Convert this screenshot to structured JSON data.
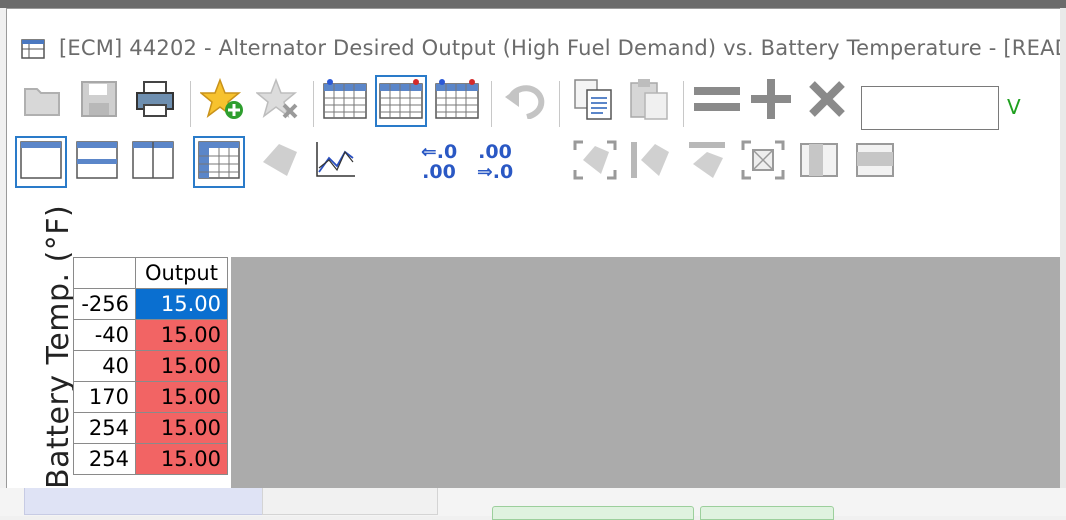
{
  "window": {
    "title": "[ECM] 44202 - Alternator Desired Output (High Fuel Demand) vs. Battery Temperature - [READ .."
  },
  "toolbar": {
    "value_input": "",
    "unit_label": "V",
    "round_up_label_top": "⇐.0",
    "round_up_label_bottom": ".00",
    "round_down_label_top": ".00",
    "round_down_label_bottom": "⇒.0"
  },
  "axis": {
    "y_label": "Battery Temp. (°F)"
  },
  "table": {
    "column_header": "Output",
    "rows": [
      {
        "temp": "-256",
        "output": "15.00"
      },
      {
        "temp": "-40",
        "output": "15.00"
      },
      {
        "temp": "40",
        "output": "15.00"
      },
      {
        "temp": "170",
        "output": "15.00"
      },
      {
        "temp": "254",
        "output": "15.00"
      },
      {
        "temp": "254",
        "output": "15.00"
      }
    ]
  },
  "colors": {
    "selected_cell": "#0a6fd0",
    "modified_cell": "#f26464",
    "unit_green": "#1fa01f"
  }
}
